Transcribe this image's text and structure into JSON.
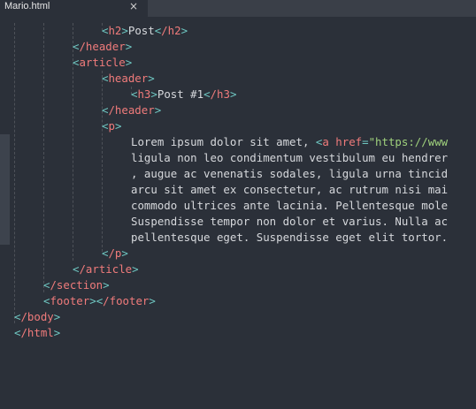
{
  "tab": {
    "title": "Mario.html",
    "close_glyph": "×"
  },
  "code": {
    "h2_open": "h2",
    "h2_text": "Post",
    "h2_close": "/h2",
    "header_close_1": "/header",
    "article_open": "article",
    "header_open": "header",
    "h3_open": "h3",
    "h3_text": "Post #1",
    "h3_close": "/h3",
    "header_close_2": "/header",
    "p_open": "p",
    "lorem_start": "Lorem ipsum dolor sit amet, ",
    "a_tag": "a",
    "href_attr": "href",
    "href_value": "\"https://www",
    "text_lines": [
      "ligula non leo condimentum vestibulum eu hendrer",
      ", augue ac venenatis sodales, ligula urna tincid",
      "arcu sit amet ex consectetur, ac rutrum nisi mai",
      "commodo ultrices ante lacinia. Pellentesque mole",
      "Suspendisse tempor non dolor et varius. Nulla ac",
      "pellentesque eget. Suspendisse eget elit tortor."
    ],
    "p_close": "/p",
    "article_close": "/article",
    "section_close": "/section",
    "footer_open": "footer",
    "footer_close": "/footer",
    "body_close": "/body",
    "html_close": "/html"
  }
}
